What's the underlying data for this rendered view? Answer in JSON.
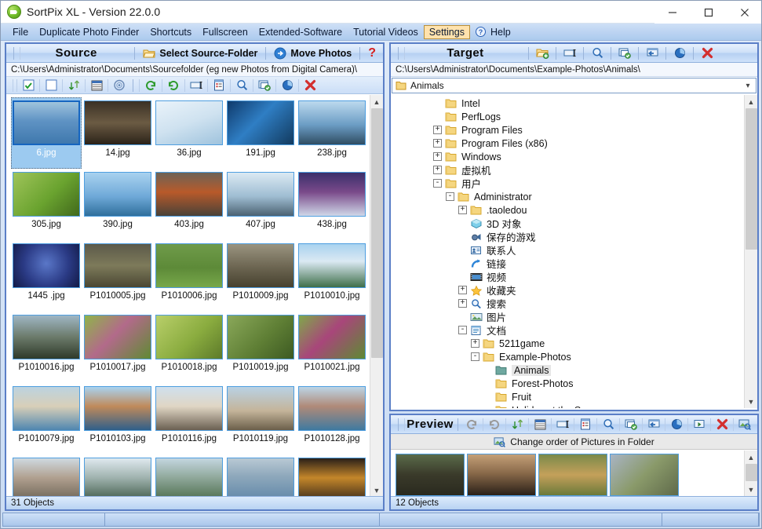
{
  "window": {
    "title": "SortPix XL - Version 22.0.0",
    "app_icon": "green-arrow-icon",
    "minimize": "minimize-icon",
    "maximize": "maximize-icon",
    "close": "close-icon"
  },
  "menu": [
    {
      "label": "File",
      "accel": "F",
      "active": false
    },
    {
      "label": "Duplicate Photo Finder",
      "accel": "D",
      "active": false
    },
    {
      "label": "Shortcuts",
      "accel": "S",
      "active": false
    },
    {
      "label": "Fullscreen",
      "accel": "u",
      "active": false
    },
    {
      "label": "Extended-Software",
      "accel": "E",
      "active": false
    },
    {
      "label": "Tutorial Videos",
      "accel": "T",
      "active": false
    },
    {
      "label": "Settings",
      "accel": "i",
      "active": true
    },
    {
      "label": "Help",
      "accel": "H",
      "active": false,
      "icon": "help-question-icon"
    }
  ],
  "source": {
    "title": "Source",
    "select_folder_label": "Select Source-Folder",
    "select_folder_icon": "open-folder-icon",
    "move_photos_label": "Move Photos",
    "move_photos_icon": "blue-arrow-right-icon",
    "help_icon": "red-question-icon",
    "path": "C:\\Users\\Administrator\\Documents\\Sourcefolder (eg new Photos from Digital Camera)\\",
    "toolbar_icons": [
      "select-all-checkbox-icon",
      "deselect-all-icon",
      "sort-updown-icon",
      "details-list-icon",
      "slideshow-icon",
      "rotate-left-icon",
      "rotate-right-icon",
      "rename-icon",
      "edit-properties-icon",
      "zoom-search-icon",
      "copy-to-folder-icon",
      "pie-statistics-icon",
      "delete-red-x-icon"
    ],
    "status": "31 Objects",
    "files": [
      {
        "name": "6.jpg",
        "selected": true,
        "art": "seal-ocean"
      },
      {
        "name": "14.jpg",
        "selected": false,
        "art": "raccoons"
      },
      {
        "name": "36.jpg",
        "selected": false,
        "art": "seal-pup"
      },
      {
        "name": "191.jpg",
        "selected": false,
        "art": "blue-macaw"
      },
      {
        "name": "238.jpg",
        "selected": false,
        "art": "penguin"
      },
      {
        "name": "305.jpg",
        "selected": false,
        "art": "chameleon"
      },
      {
        "name": "390.jpg",
        "selected": false,
        "art": "windsurf-sky"
      },
      {
        "name": "403.jpg",
        "selected": false,
        "art": "rafting"
      },
      {
        "name": "407.jpg",
        "selected": false,
        "art": "windsurf-wave"
      },
      {
        "name": "438.jpg",
        "selected": false,
        "art": "skier"
      },
      {
        "name": "1445 .jpg",
        "selected": false,
        "art": "owl"
      },
      {
        "name": "P1010005.jpg",
        "selected": false,
        "art": "forest1"
      },
      {
        "name": "P1010006.jpg",
        "selected": false,
        "art": "orchard"
      },
      {
        "name": "P1010009.jpg",
        "selected": false,
        "art": "forest2"
      },
      {
        "name": "P1010010.jpg",
        "selected": false,
        "art": "lake-mountain"
      },
      {
        "name": "P1010016.jpg",
        "selected": false,
        "art": "cliff"
      },
      {
        "name": "P1010017.jpg",
        "selected": false,
        "art": "blossom"
      },
      {
        "name": "P1010018.jpg",
        "selected": false,
        "art": "apples"
      },
      {
        "name": "P1010019.jpg",
        "selected": false,
        "art": "leaves"
      },
      {
        "name": "P1010021.jpg",
        "selected": false,
        "art": "berries"
      },
      {
        "name": "P1010079.jpg",
        "selected": false,
        "art": "boat-rocks"
      },
      {
        "name": "P1010103.jpg",
        "selected": false,
        "art": "venice-canal"
      },
      {
        "name": "P1010116.jpg",
        "selected": false,
        "art": "doge-palace"
      },
      {
        "name": "P1010119.jpg",
        "selected": false,
        "art": "venice-dock"
      },
      {
        "name": "P1010128.jpg",
        "selected": false,
        "art": "grand-canal"
      },
      {
        "name": "",
        "selected": false,
        "art": "rialto-bridge"
      },
      {
        "name": "",
        "selected": false,
        "art": "misty-mountain"
      },
      {
        "name": "",
        "selected": false,
        "art": "valley"
      },
      {
        "name": "",
        "selected": false,
        "art": "sea"
      },
      {
        "name": "",
        "selected": false,
        "art": "sunset-pier"
      }
    ]
  },
  "target": {
    "title": "Target",
    "toolbar_icons": [
      "new-folder-icon",
      "rename-folder-icon",
      "zoom-search-icon",
      "copy-to-folder-icon",
      "move-back-icon",
      "pie-statistics-icon",
      "delete-red-x-icon"
    ],
    "path": "C:\\Users\\Administrator\\Documents\\Example-Photos\\Animals\\",
    "combo_value": "Animals",
    "combo_icon": "folder-icon",
    "combo_arrow": "chevron-down-icon",
    "tree": [
      {
        "label": "Intel",
        "depth": 3,
        "expander": "",
        "icon": "folder-icon",
        "selected": false
      },
      {
        "label": "PerfLogs",
        "depth": 3,
        "expander": "",
        "icon": "folder-icon",
        "selected": false
      },
      {
        "label": "Program Files",
        "depth": 3,
        "expander": "+",
        "icon": "folder-icon",
        "selected": false
      },
      {
        "label": "Program Files (x86)",
        "depth": 3,
        "expander": "+",
        "icon": "folder-icon",
        "selected": false
      },
      {
        "label": "Windows",
        "depth": 3,
        "expander": "+",
        "icon": "folder-icon",
        "selected": false
      },
      {
        "label": "虚拟机",
        "depth": 3,
        "expander": "+",
        "icon": "folder-icon",
        "selected": false
      },
      {
        "label": "用户",
        "depth": 3,
        "expander": "-",
        "icon": "folder-icon",
        "selected": false
      },
      {
        "label": "Administrator",
        "depth": 4,
        "expander": "-",
        "icon": "folder-icon",
        "selected": false
      },
      {
        "label": ".taoledou",
        "depth": 5,
        "expander": "+",
        "icon": "folder-icon",
        "selected": false
      },
      {
        "label": "3D 对象",
        "depth": 5,
        "expander": "",
        "icon": "cube-3d-icon",
        "selected": false
      },
      {
        "label": "保存的游戏",
        "depth": 5,
        "expander": "",
        "icon": "saved-games-icon",
        "selected": false
      },
      {
        "label": "联系人",
        "depth": 5,
        "expander": "",
        "icon": "contacts-icon",
        "selected": false
      },
      {
        "label": "链接",
        "depth": 5,
        "expander": "",
        "icon": "links-icon",
        "selected": false
      },
      {
        "label": "视频",
        "depth": 5,
        "expander": "",
        "icon": "videos-icon",
        "selected": false
      },
      {
        "label": "收藏夹",
        "depth": 5,
        "expander": "+",
        "icon": "favorites-star-icon",
        "selected": false
      },
      {
        "label": "搜索",
        "depth": 5,
        "expander": "+",
        "icon": "search-icon",
        "selected": false
      },
      {
        "label": "图片",
        "depth": 5,
        "expander": "",
        "icon": "pictures-icon",
        "selected": false
      },
      {
        "label": "文档",
        "depth": 5,
        "expander": "-",
        "icon": "documents-icon",
        "selected": false
      },
      {
        "label": "5211game",
        "depth": 6,
        "expander": "+",
        "icon": "folder-icon",
        "selected": false
      },
      {
        "label": "Example-Photos",
        "depth": 6,
        "expander": "-",
        "icon": "folder-icon",
        "selected": false
      },
      {
        "label": "Animals",
        "depth": 7,
        "expander": "",
        "icon": "folder-teal-icon",
        "selected": true
      },
      {
        "label": "Forest-Photos",
        "depth": 7,
        "expander": "",
        "icon": "folder-icon",
        "selected": false
      },
      {
        "label": "Fruit",
        "depth": 7,
        "expander": "",
        "icon": "folder-icon",
        "selected": false
      },
      {
        "label": "Holiday at the Sea",
        "depth": 7,
        "expander": "",
        "icon": "folder-icon",
        "selected": false
      }
    ]
  },
  "preview": {
    "title": "Preview",
    "toolbar_icons": [
      "rotate-left-icon",
      "rotate-right-icon",
      "sort-updown-icon",
      "details-list-icon",
      "rename-icon",
      "edit-properties-icon",
      "zoom-search-icon",
      "copy-to-folder-icon",
      "move-back-icon",
      "pie-statistics-icon",
      "slideshow-play-icon",
      "delete-red-x-icon",
      "change-order-icon"
    ],
    "change_order_label": "Change order of Pictures in Folder",
    "change_order_icon": "change-order-icon",
    "status": "12 Objects",
    "files": [
      {
        "art": "vultures"
      },
      {
        "art": "acacia-tree"
      },
      {
        "art": "cheetah"
      },
      {
        "art": "insect"
      }
    ]
  },
  "colors": {
    "accent_blue": "#5b7fc7",
    "header_blue": "#cde0f8",
    "menu_blue": "#bdd4f2",
    "selection": "#9ccaf0",
    "highlight_yellow": "#ffe2ad",
    "red_x": "#d32f2f",
    "folder_yellow": "#f5d680"
  }
}
